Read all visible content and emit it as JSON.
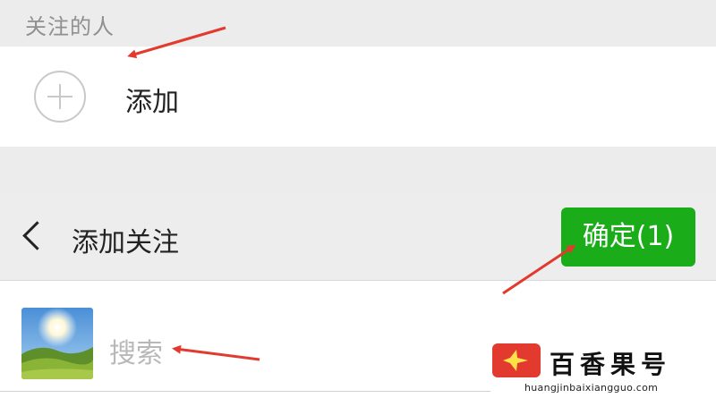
{
  "follow_section": {
    "header_title": "关注的人",
    "add_label": "添加"
  },
  "add_follow": {
    "title": "添加关注",
    "confirm_label": "确定(1)",
    "search_placeholder": "搜索"
  },
  "watermark": {
    "brand": "百香果号",
    "url": "huangjinbaixiangguo.com"
  },
  "colors": {
    "confirm_green": "#1aad19",
    "annotation_red": "#e23a2e",
    "background": "#ececec"
  },
  "icons": [
    "plus-circle-icon",
    "back-chevron-icon",
    "avatar-image",
    "annotation-arrow-icon",
    "logo-icon"
  ]
}
